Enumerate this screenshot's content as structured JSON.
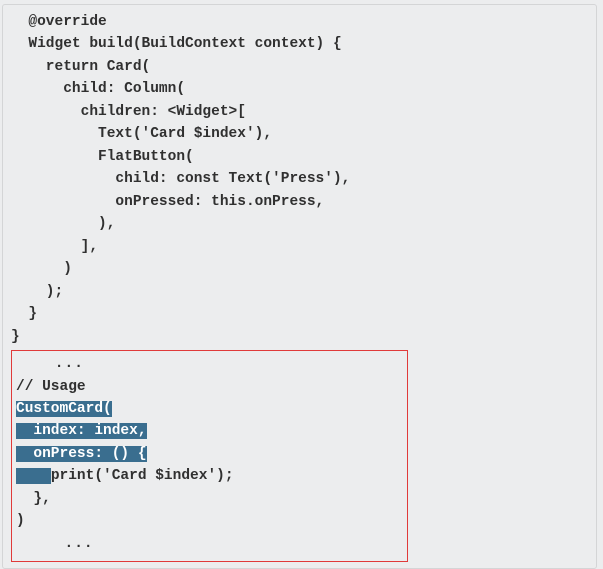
{
  "code": {
    "l1": "  @override",
    "l2": "  Widget build(BuildContext context) {",
    "l3": "    return Card(",
    "l4": "      child: Column(",
    "l5": "        children: <Widget>[",
    "l6": "          Text('Card $index'),",
    "l7": "          FlatButton(",
    "l8": "            child: const Text('Press'),",
    "l9": "            onPressed: this.onPress,",
    "l10": "          ),",
    "l11": "        ],",
    "l12": "      )",
    "l13": "    );",
    "l14": "  }",
    "l15": "}"
  },
  "usage": {
    "ellipsis_top": "    ...",
    "comment": "// Usage",
    "h1": "CustomCard(",
    "h2_pre": "  ",
    "h2": "index: index,",
    "h3_pre": "  ",
    "h3": "onPress: () {",
    "h4_pre": "    ",
    "h4_post": "print('Card $index');",
    "h5_pre": "  ",
    "h5": "},",
    "h6": ")",
    "ellipsis_bottom": "     ..."
  }
}
